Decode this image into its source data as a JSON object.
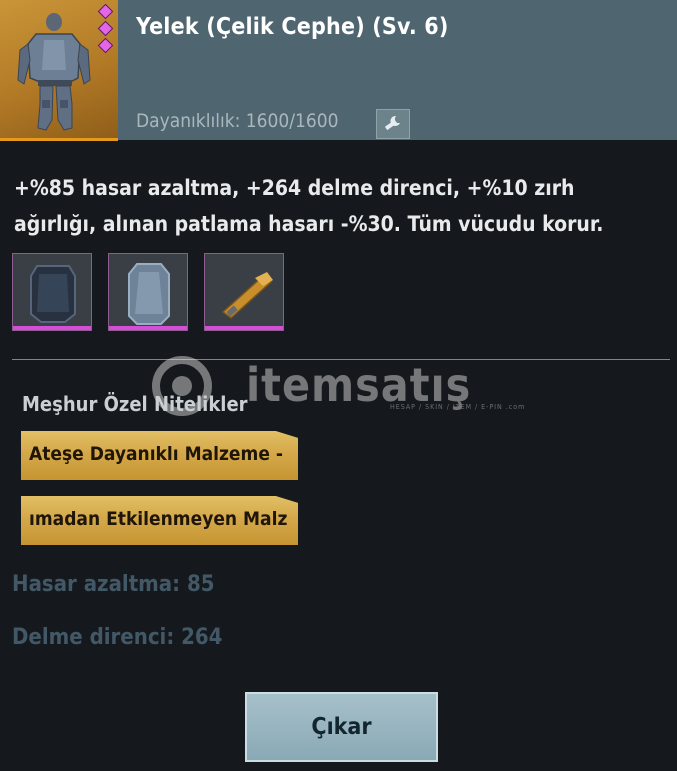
{
  "item": {
    "title": "Yelek (Çelik Cephe) (Sv. 6)",
    "durability_text": "Dayanıklılık: 1600/1600",
    "thumbnail_icon": "armor-vest-icon",
    "rarity_color": "#e266e5",
    "repair_icon": "wrench-icon"
  },
  "description": "+%85 hasar azaltma, +264 delme direnci, +%10 zırh ağırlığı, alınan patlama hasarı -%30. Tüm vücudu korur.",
  "attachments": [
    {
      "icon": "armor-plate-icon"
    },
    {
      "icon": "armor-plate-icon"
    },
    {
      "icon": "strap-icon"
    }
  ],
  "watermark": {
    "brand": "itemsatış",
    "tagline": "HESAP / SKIN / ITEM / E-PIN",
    "suffix": ".com"
  },
  "special": {
    "title": "Meşhur Özel Nitelikler",
    "traits": [
      "Ateşe Dayanıklı Malzeme -",
      "ımadan Etkilenmeyen Malz"
    ]
  },
  "stats": {
    "damage_reduction": "Hasar azaltma: 85",
    "pierce_resistance": "Delme direnci: 264"
  },
  "actions": {
    "remove_label": "Çıkar"
  },
  "colors": {
    "header_bg": "#4f6570",
    "thumb_bg": "#c08a32",
    "trait_gold": "#d4a84a",
    "button_bg": "#95b3be",
    "slot_accent": "#d34fd6"
  }
}
